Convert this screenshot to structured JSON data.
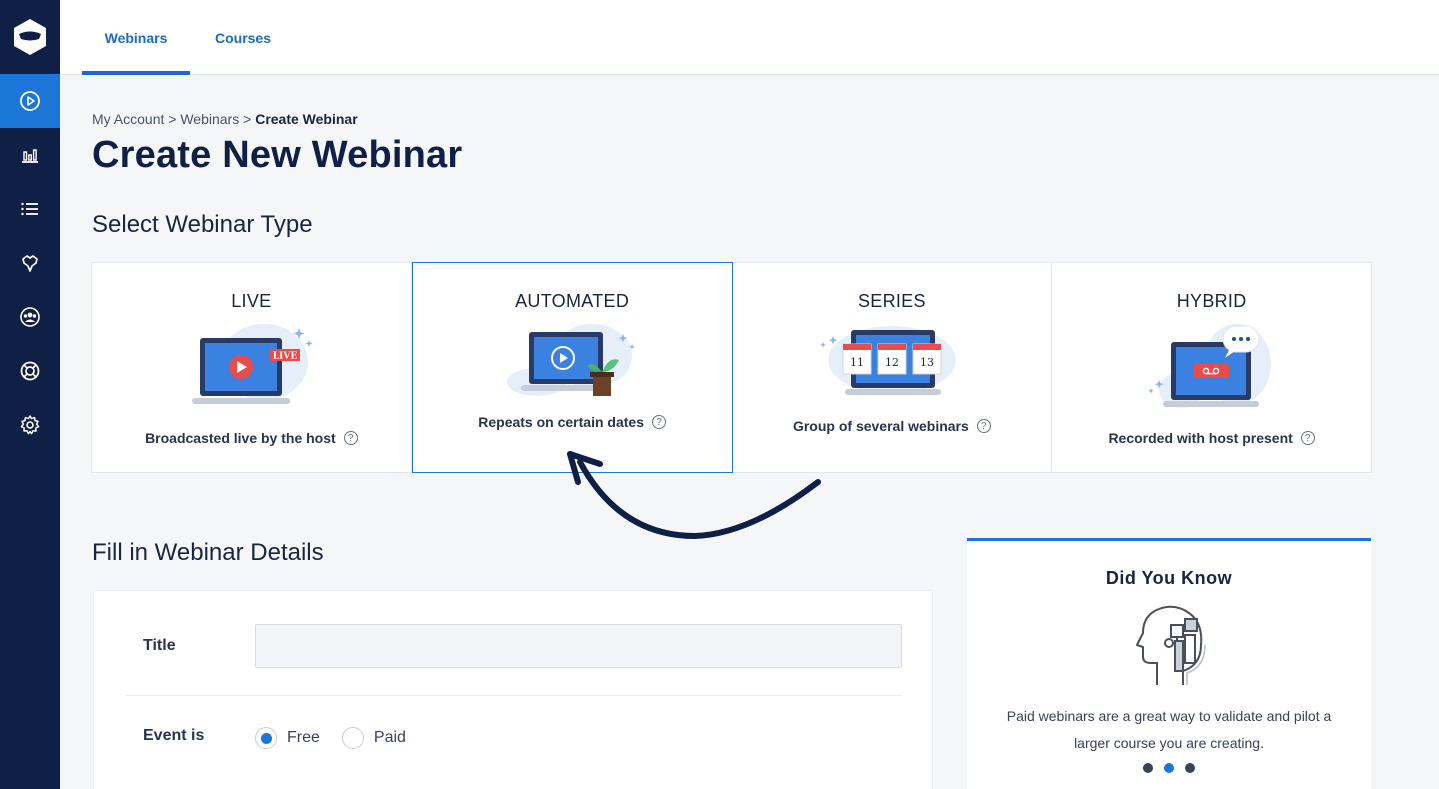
{
  "tabs": {
    "webinars": "Webinars",
    "courses": "Courses"
  },
  "breadcrumb": {
    "part1": "My Account",
    "sep1": " > ",
    "part2": "Webinars",
    "sep2": " > ",
    "current": "Create Webinar"
  },
  "page_title": "Create New Webinar",
  "section_type_title": "Select Webinar Type",
  "webinar_types": [
    {
      "name": "LIVE",
      "desc": "Broadcasted live by the host",
      "badge": "LIVE"
    },
    {
      "name": "AUTOMATED",
      "desc": "Repeats on certain dates"
    },
    {
      "name": "SERIES",
      "desc": "Group of several webinars",
      "dates": [
        "11",
        "12",
        "13"
      ]
    },
    {
      "name": "HYBRID",
      "desc": "Recorded with host present"
    }
  ],
  "selected_type": "AUTOMATED",
  "help_glyph": "?",
  "section_details_title": "Fill in Webinar Details",
  "form": {
    "title_label": "Title",
    "title_value": "",
    "event_label": "Event is",
    "option_free": "Free",
    "option_paid": "Paid",
    "selected_option": "Free"
  },
  "did_you_know": {
    "title": "Did You Know",
    "text": "Paid webinars are a great way to validate and pilot a larger course you are creating.",
    "active_dot": 1
  },
  "colors": {
    "sidebar": "#101f45",
    "accent": "#1c76d8",
    "live_red": "#ea4b4b"
  }
}
